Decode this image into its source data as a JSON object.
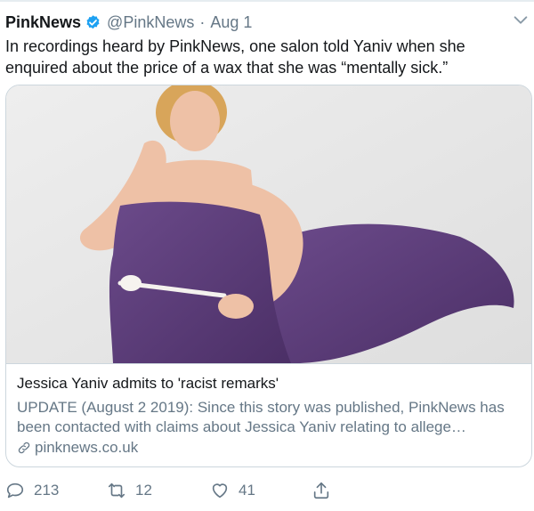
{
  "tweet": {
    "author_name": "PinkNews",
    "handle": "@PinkNews",
    "separator": "·",
    "date": "Aug 1",
    "text": "In recordings heard by PinkNews, one salon told Yaniv when she enquired about the price of a wax that she was “mentally sick.”"
  },
  "card": {
    "title": "Jessica Yaniv admits to 'racist remarks'",
    "description": "UPDATE (August 2 2019): Since this story was published, PinkNews has been contacted with claims about Jessica Yaniv relating to allege…",
    "domain": "pinknews.co.uk"
  },
  "actions": {
    "reply_count": "213",
    "retweet_count": "12",
    "like_count": "41"
  },
  "icons": {
    "verified": "verified-badge-icon",
    "caret": "chevron-down-icon",
    "link": "link-icon",
    "reply": "reply-icon",
    "retweet": "retweet-icon",
    "like": "heart-icon",
    "share": "share-icon"
  },
  "colors": {
    "verified_blue": "#1da1f2",
    "secondary_text": "#657786",
    "primary_text": "#14171a",
    "border": "#ccd6dd",
    "dress_purple": "#5a3a78"
  }
}
